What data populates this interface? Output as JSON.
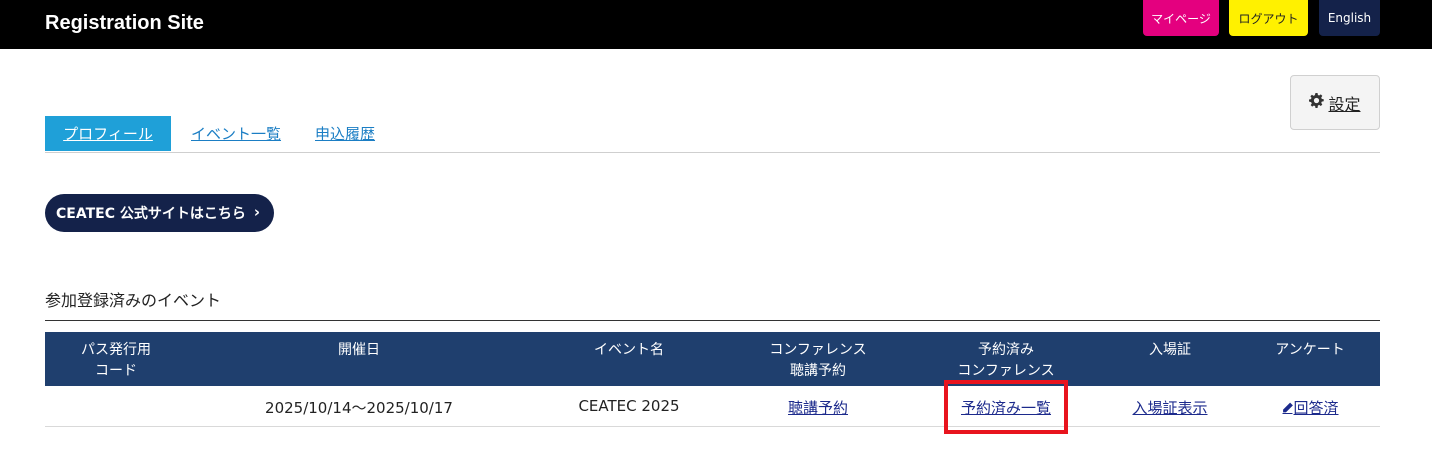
{
  "header": {
    "site_title": "Registration Site",
    "buttons": {
      "mypage": "マイページ",
      "logout": "ログアウト",
      "english": "English"
    },
    "colors": {
      "background": "#000000",
      "mypage": "#e4007f",
      "logout": "#fff100",
      "english": "#14224a"
    }
  },
  "settings": {
    "icon": "gear-icon",
    "label": "設定"
  },
  "tabs": [
    {
      "label": "プロフィール",
      "active": true
    },
    {
      "label": "イベント一覧",
      "active": false
    },
    {
      "label": "申込履歴",
      "active": false
    }
  ],
  "official_site_button": {
    "label": "CEATEC 公式サイトはこちら",
    "icon": "chevron-right-icon"
  },
  "section": {
    "title": "参加登録済みのイベント"
  },
  "table": {
    "headers": [
      [
        "パス発行用",
        "コード"
      ],
      [
        "開催日"
      ],
      [
        "イベント名"
      ],
      [
        "コンファレンス",
        "聴講予約"
      ],
      [
        "予約済み",
        "コンファレンス"
      ],
      [
        "入場証"
      ],
      [
        "アンケート"
      ]
    ],
    "rows": [
      {
        "code": "",
        "date": "2025/10/14〜2025/10/17",
        "event_name": "CEATEC 2025",
        "conference_reserve": "聴講予約",
        "reserved_list": "予約済み一覧",
        "admission": "入場証表示",
        "survey": "回答済",
        "survey_icon": "pencil-icon"
      }
    ]
  }
}
